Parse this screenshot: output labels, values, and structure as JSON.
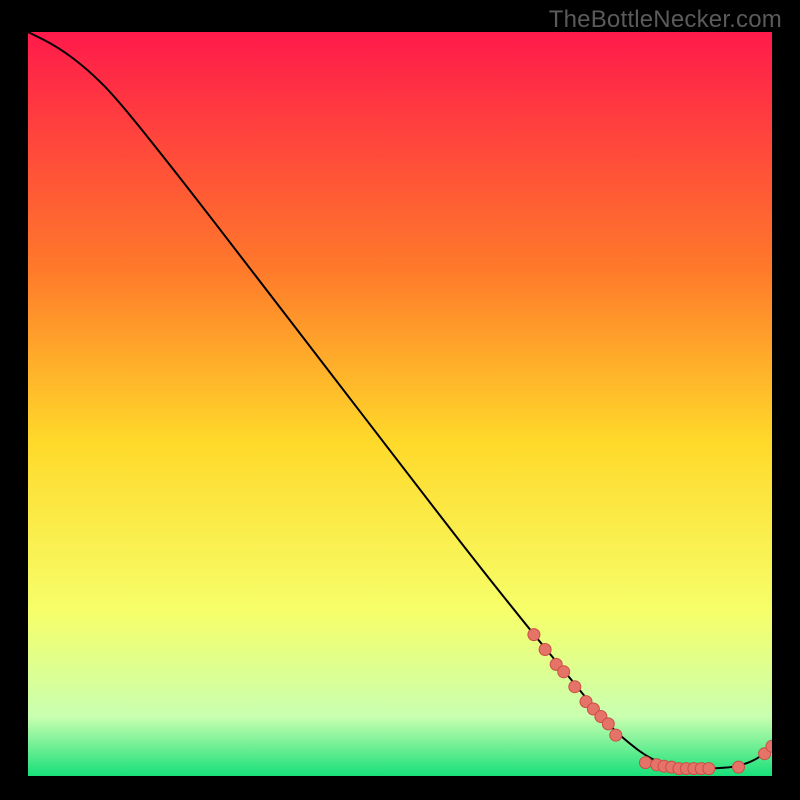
{
  "watermark": "TheBottleNecker.com",
  "colors": {
    "background": "#000000",
    "gradient_top": "#ff1a4b",
    "gradient_mid_upper": "#ff7a2a",
    "gradient_mid": "#ffd92a",
    "gradient_mid_lower": "#f6ff6a",
    "gradient_low": "#c9ffb0",
    "gradient_bottom": "#18e07a",
    "curve": "#000000",
    "marker_fill": "#e57368",
    "marker_stroke": "#c94f45"
  },
  "chart_data": {
    "type": "line",
    "title": "",
    "xlabel": "",
    "ylabel": "",
    "xlim": [
      0,
      100
    ],
    "ylim": [
      0,
      100
    ],
    "grid": false,
    "series": [
      {
        "name": "bottleneck-curve",
        "x": [
          0,
          4,
          8,
          12,
          20,
          30,
          40,
          50,
          60,
          68,
          73,
          77,
          80,
          84,
          88,
          92,
          95,
          98,
          100
        ],
        "y": [
          100,
          98,
          95,
          91,
          81,
          68,
          55,
          42,
          29,
          19,
          13,
          8,
          5,
          2,
          1,
          1,
          1.2,
          2.2,
          4
        ]
      }
    ],
    "markers": [
      {
        "name": "cluster-descending",
        "points": [
          [
            68.0,
            19.0
          ],
          [
            69.5,
            17.0
          ],
          [
            71.0,
            15.0
          ],
          [
            72.0,
            14.0
          ],
          [
            73.5,
            12.0
          ],
          [
            75.0,
            10.0
          ],
          [
            76.0,
            9.0
          ],
          [
            77.0,
            8.0
          ],
          [
            78.0,
            7.0
          ],
          [
            79.0,
            5.5
          ]
        ]
      },
      {
        "name": "cluster-bottom",
        "points": [
          [
            83.0,
            1.8
          ],
          [
            84.5,
            1.5
          ],
          [
            85.5,
            1.3
          ],
          [
            86.5,
            1.2
          ],
          [
            87.5,
            1.0
          ],
          [
            88.5,
            1.0
          ],
          [
            89.5,
            1.0
          ],
          [
            90.5,
            1.0
          ],
          [
            91.5,
            1.0
          ]
        ]
      },
      {
        "name": "cluster-gap",
        "points": [
          [
            95.5,
            1.2
          ]
        ]
      },
      {
        "name": "cluster-rising",
        "points": [
          [
            99.0,
            3.0
          ],
          [
            100.0,
            4.0
          ]
        ]
      }
    ]
  }
}
